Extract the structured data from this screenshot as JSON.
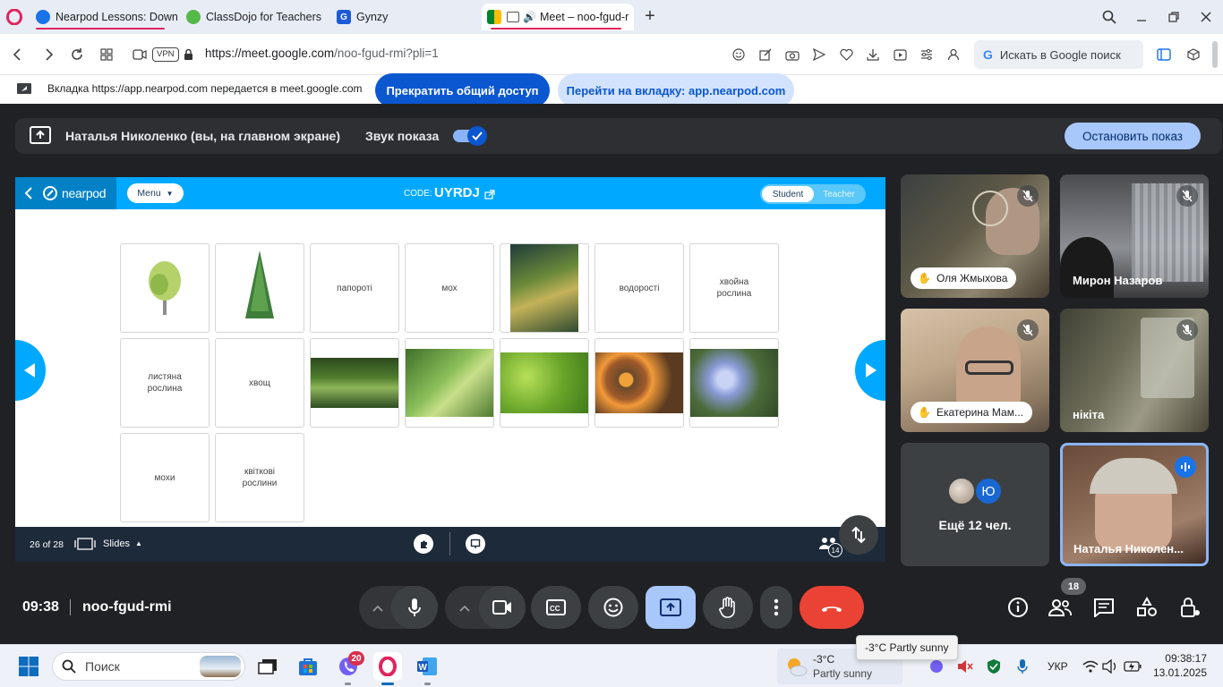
{
  "browser": {
    "tabs": [
      {
        "title": "Nearpod Lessons: Downlo",
        "color": "#1a73e8"
      },
      {
        "title": "ClassDojo for Teachers",
        "color": "#54b948"
      },
      {
        "title": "Gynzy",
        "color": "#1e5bd7"
      },
      {
        "title": "Meet – noo-fgud-r",
        "color": "#00832d"
      }
    ],
    "url_host": "https://meet.google.com",
    "url_path": "/noo-fgud-rmi?pli=1",
    "vpn_badge": "VPN",
    "search_label": "Искать в Google поиск"
  },
  "share_banner": {
    "message": "Вкладка https://app.nearpod.com передается в meet.google.com",
    "stop_button": "Прекратить общий доступ",
    "switch_button": "Перейти на вкладку: app.nearpod.com"
  },
  "presentation_bar": {
    "presenter": "Наталья Николенко (вы, на главном экране)",
    "sound_label": "Звук показа",
    "stop_button": "Остановить показ"
  },
  "nearpod": {
    "logo": "nearpod",
    "menu_label": "Menu",
    "code_label": "CODE:",
    "code": "UYRDJ",
    "mode_student": "Student",
    "mode_teacher": "Teacher",
    "cards": [
      {
        "text": "",
        "image": "birch"
      },
      {
        "text": "",
        "image": "conifer"
      },
      {
        "text": "папороті",
        "image": ""
      },
      {
        "text": "мох",
        "image": ""
      },
      {
        "text": "",
        "image": "algae"
      },
      {
        "text": "водорості",
        "image": ""
      },
      {
        "text": "хвойна рослина",
        "image": ""
      },
      {
        "text": "листяна рослина",
        "image": ""
      },
      {
        "text": "хвощ",
        "image": ""
      },
      {
        "text": "",
        "image": "horsetail"
      },
      {
        "text": "",
        "image": "fern"
      },
      {
        "text": "",
        "image": "moss"
      },
      {
        "text": "",
        "image": "orange-flowers"
      },
      {
        "text": "",
        "image": "blue-flowers"
      },
      {
        "text": "мохи",
        "image": ""
      },
      {
        "text": "квіткові рослини",
        "image": ""
      }
    ],
    "slide_counter": "26 of 28",
    "slides_label": "Slides",
    "participants_badge": "14"
  },
  "participants": [
    {
      "name": "Оля Жмыхова",
      "hand_raised": true
    },
    {
      "name": "Мирон Назаров",
      "hand_raised": false
    },
    {
      "name": "Екатерина Мам...",
      "hand_raised": true
    },
    {
      "name": "нікіта",
      "hand_raised": false
    }
  ],
  "more_tile": {
    "label": "Ещё 12 чел.",
    "avatar_letter": "Ю"
  },
  "self_tile": {
    "name": "Наталья Николен..."
  },
  "meeting": {
    "time": "09:38",
    "code": "noo-fgud-rmi",
    "people_count": "18"
  },
  "colors": {
    "meet_bg": "#202124",
    "accent_blue": "#0b57d0",
    "nearpod_blue": "#00a8ff",
    "end_call": "#ea4335",
    "share_active": "#a8c7fa"
  },
  "taskbar": {
    "search_label": "Поиск",
    "viber_badge": "20",
    "weather_temp": "-3°C",
    "weather_desc": "Partly sunny",
    "weather_tooltip": "-3°C Partly sunny",
    "lang": "УКР",
    "clock_time": "09:38:17",
    "clock_date": "13.01.2025"
  }
}
